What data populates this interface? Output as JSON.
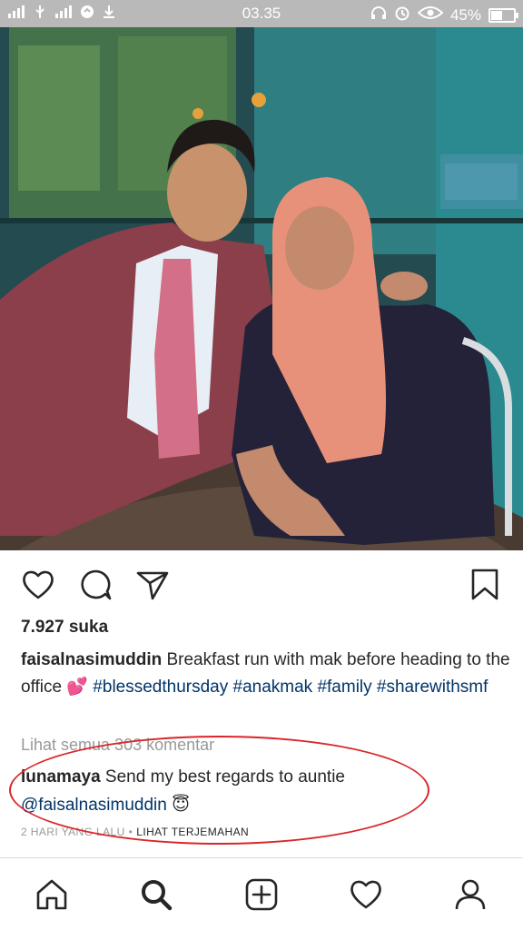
{
  "status_bar": {
    "time": "03.35",
    "battery": "45%",
    "battery_level": 0.45,
    "left_icons": [
      "signal-icon",
      "usb-icon",
      "signal-icon",
      "sync-icon",
      "download-icon"
    ],
    "right_icons": [
      "headset-icon",
      "alarm-icon",
      "eye-icon",
      "battery-icon"
    ]
  },
  "post": {
    "photo": "photo",
    "likes": "7.927 suka",
    "caption": {
      "username": "faisalnasimuddin",
      "text": " Breakfast run with mak before heading to the office ",
      "emoji": "💕",
      "hashtags": " #blessedthursday #anakmak #family #sharewithsmf"
    },
    "view_all_comments": "Lihat semua 303 komentar",
    "comment": {
      "username": "lunamaya",
      "text": " Send my best regards to auntie ",
      "mention": "@faisalnasimuddin",
      "emoji": "😇"
    },
    "time_ago": "2 HARI YANG LALU",
    "separator": "•",
    "translate": "LIHAT TERJEMAHAN"
  },
  "actions": {
    "icons": [
      "heart-icon",
      "comment-icon",
      "share-icon",
      "bookmark-icon"
    ]
  },
  "nav": {
    "icons": [
      "home-icon",
      "search-icon",
      "add-post-icon",
      "activity-heart-icon",
      "profile-icon"
    ]
  },
  "colors": {
    "status_bar": "#b9b9b9",
    "text": "#262626",
    "hashtag": "#003569",
    "muted": "#999999",
    "annotation": "#d9262a"
  }
}
